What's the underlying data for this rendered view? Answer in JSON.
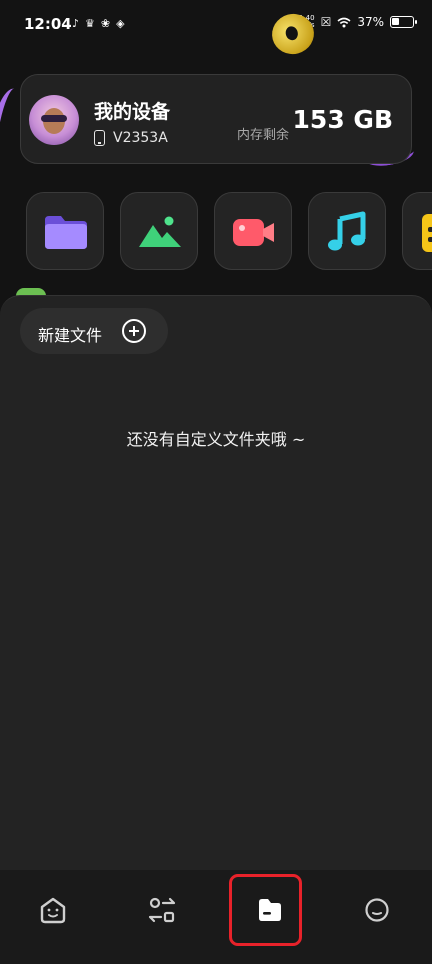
{
  "status_bar": {
    "time": "12:04",
    "net_speed_value": "1.40",
    "net_speed_unit": "KB/s",
    "battery_percent": "37%",
    "battery_level": 0.37,
    "left_icon_names": [
      "tiktok-icon",
      "crown-icon",
      "pinwheel-icon",
      "leaf-icon"
    ],
    "right_icon_names": [
      "vibrate-icon",
      "sim-icon",
      "wifi-icon",
      "battery-icon"
    ]
  },
  "device_card": {
    "title": "我的设备",
    "model": "V2353A",
    "storage_label": "内存剩余",
    "storage_value": "153 GB"
  },
  "categories": [
    {
      "icon": "folder-icon",
      "color": "#8f6bff"
    },
    {
      "icon": "image-icon",
      "color": "#3fd17a"
    },
    {
      "icon": "video-icon",
      "color": "#ff5a6a"
    },
    {
      "icon": "music-icon",
      "color": "#35d0e8"
    },
    {
      "icon": "document-icon",
      "color": "#f5c518"
    }
  ],
  "main": {
    "new_file_label": "新建文件",
    "empty_message": "还没有自定义文件夹哦 ~"
  },
  "bottom_nav": {
    "items": [
      {
        "icon": "home-face-icon",
        "selected": false
      },
      {
        "icon": "transfer-icon",
        "selected": false
      },
      {
        "icon": "file-icon",
        "selected": true
      },
      {
        "icon": "profile-icon",
        "selected": false
      }
    ],
    "highlight_color": "#e8222a"
  }
}
